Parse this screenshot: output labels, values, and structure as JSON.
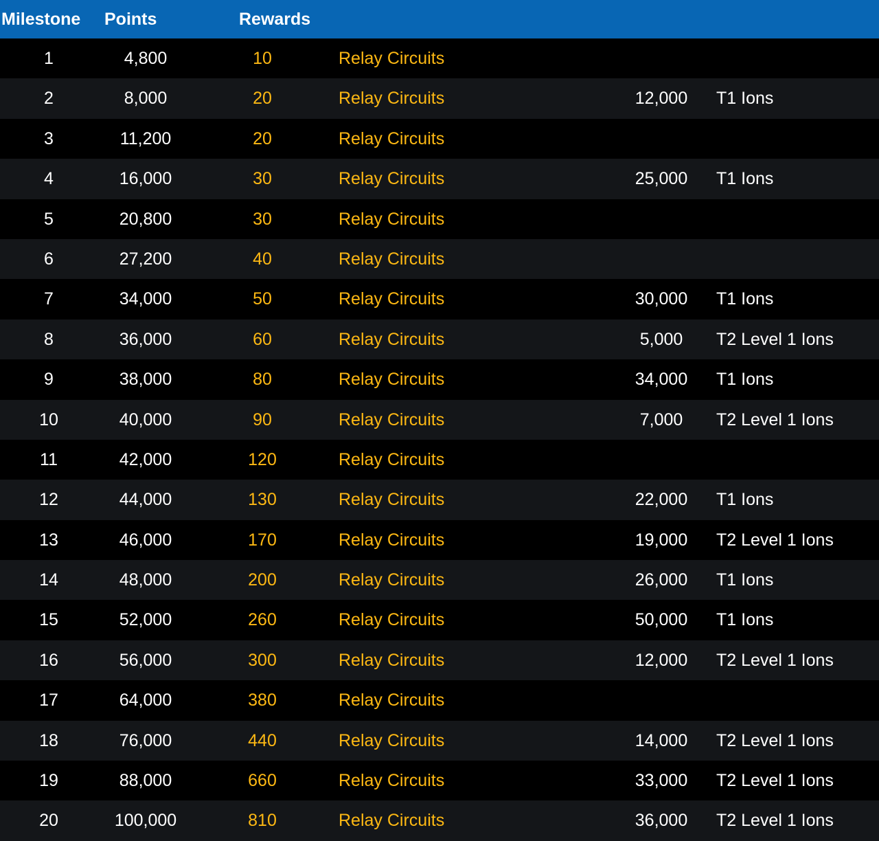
{
  "header": {
    "milestone": "Milestone",
    "points": "Points",
    "rewards": "Rewards"
  },
  "colors": {
    "header_bg": "#0866b4",
    "row_dark": "#000000",
    "row_alt": "#141619",
    "reward_text": "#fdb813",
    "text": "#ffffff"
  },
  "rows": [
    {
      "milestone": "1",
      "points": "4,800",
      "reward_amount": "10",
      "reward_item": "Relay Circuits",
      "bonus_amount": "",
      "bonus_item": ""
    },
    {
      "milestone": "2",
      "points": "8,000",
      "reward_amount": "20",
      "reward_item": "Relay Circuits",
      "bonus_amount": "12,000",
      "bonus_item": "T1 Ions"
    },
    {
      "milestone": "3",
      "points": "11,200",
      "reward_amount": "20",
      "reward_item": "Relay Circuits",
      "bonus_amount": "",
      "bonus_item": ""
    },
    {
      "milestone": "4",
      "points": "16,000",
      "reward_amount": "30",
      "reward_item": "Relay Circuits",
      "bonus_amount": "25,000",
      "bonus_item": "T1 Ions"
    },
    {
      "milestone": "5",
      "points": "20,800",
      "reward_amount": "30",
      "reward_item": "Relay Circuits",
      "bonus_amount": "",
      "bonus_item": ""
    },
    {
      "milestone": "6",
      "points": "27,200",
      "reward_amount": "40",
      "reward_item": "Relay Circuits",
      "bonus_amount": "",
      "bonus_item": ""
    },
    {
      "milestone": "7",
      "points": "34,000",
      "reward_amount": "50",
      "reward_item": "Relay Circuits",
      "bonus_amount": "30,000",
      "bonus_item": "T1 Ions"
    },
    {
      "milestone": "8",
      "points": "36,000",
      "reward_amount": "60",
      "reward_item": "Relay Circuits",
      "bonus_amount": "5,000",
      "bonus_item": "T2 Level 1 Ions"
    },
    {
      "milestone": "9",
      "points": "38,000",
      "reward_amount": "80",
      "reward_item": "Relay Circuits",
      "bonus_amount": "34,000",
      "bonus_item": "T1 Ions"
    },
    {
      "milestone": "10",
      "points": "40,000",
      "reward_amount": "90",
      "reward_item": "Relay Circuits",
      "bonus_amount": "7,000",
      "bonus_item": "T2 Level 1 Ions"
    },
    {
      "milestone": "11",
      "points": "42,000",
      "reward_amount": "120",
      "reward_item": "Relay Circuits",
      "bonus_amount": "",
      "bonus_item": ""
    },
    {
      "milestone": "12",
      "points": "44,000",
      "reward_amount": "130",
      "reward_item": "Relay Circuits",
      "bonus_amount": "22,000",
      "bonus_item": "T1 Ions"
    },
    {
      "milestone": "13",
      "points": "46,000",
      "reward_amount": "170",
      "reward_item": "Relay Circuits",
      "bonus_amount": "19,000",
      "bonus_item": "T2 Level 1 Ions"
    },
    {
      "milestone": "14",
      "points": "48,000",
      "reward_amount": "200",
      "reward_item": "Relay Circuits",
      "bonus_amount": "26,000",
      "bonus_item": "T1 Ions"
    },
    {
      "milestone": "15",
      "points": "52,000",
      "reward_amount": "260",
      "reward_item": "Relay Circuits",
      "bonus_amount": "50,000",
      "bonus_item": "T1 Ions"
    },
    {
      "milestone": "16",
      "points": "56,000",
      "reward_amount": "300",
      "reward_item": "Relay Circuits",
      "bonus_amount": "12,000",
      "bonus_item": "T2 Level 1 Ions"
    },
    {
      "milestone": "17",
      "points": "64,000",
      "reward_amount": "380",
      "reward_item": "Relay Circuits",
      "bonus_amount": "",
      "bonus_item": ""
    },
    {
      "milestone": "18",
      "points": "76,000",
      "reward_amount": "440",
      "reward_item": "Relay Circuits",
      "bonus_amount": "14,000",
      "bonus_item": "T2 Level 1 Ions"
    },
    {
      "milestone": "19",
      "points": "88,000",
      "reward_amount": "660",
      "reward_item": "Relay Circuits",
      "bonus_amount": "33,000",
      "bonus_item": "T2 Level 1 Ions"
    },
    {
      "milestone": "20",
      "points": "100,000",
      "reward_amount": "810",
      "reward_item": "Relay Circuits",
      "bonus_amount": "36,000",
      "bonus_item": "T2 Level 1 Ions"
    }
  ]
}
